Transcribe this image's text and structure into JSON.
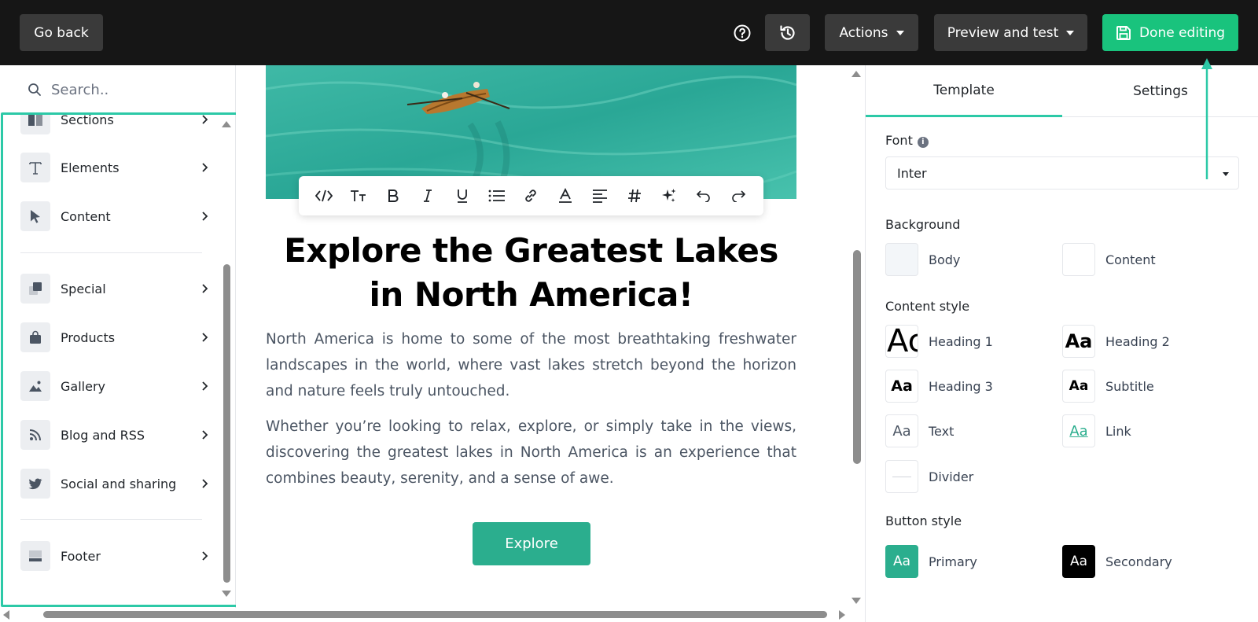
{
  "topbar": {
    "go_back": "Go back",
    "actions": "Actions",
    "preview": "Preview and test",
    "done": "Done editing"
  },
  "sidebar": {
    "search_placeholder": "Search..",
    "items": [
      {
        "label": "Sections",
        "icon": "sections-icon"
      },
      {
        "label": "Elements",
        "icon": "text-icon"
      },
      {
        "label": "Content",
        "icon": "cursor-icon"
      },
      {
        "label": "Special",
        "icon": "layers-icon"
      },
      {
        "label": "Products",
        "icon": "shopping-bag-icon"
      },
      {
        "label": "Gallery",
        "icon": "image-icon"
      },
      {
        "label": "Blog and RSS",
        "icon": "rss-icon"
      },
      {
        "label": "Social and sharing",
        "icon": "twitter-icon"
      },
      {
        "label": "Footer",
        "icon": "footer-icon"
      }
    ]
  },
  "canvas": {
    "headline": "Explore the Greatest Lakes in North America!",
    "para1": "North America is home to some of the most breathtaking freshwater landscapes in the world, where vast lakes stretch beyond the horizon and nature feels truly untouched.",
    "para2": "Whether you’re looking to relax, explore, or simply take in the views, discovering the greatest lakes in North America is an experience that combines beauty, serenity, and a sense of awe.",
    "button": "Explore"
  },
  "right_panel": {
    "tabs": [
      "Template",
      "Settings"
    ],
    "font_title": "Font",
    "font_value": "Inter",
    "background_title": "Background",
    "background": [
      "Body",
      "Content"
    ],
    "content_style_title": "Content style",
    "content_styles": [
      "Heading 1",
      "Heading 2",
      "Heading 3",
      "Subtitle",
      "Text",
      "Link",
      "Divider"
    ],
    "swatch_text": {
      "h1": "Ac",
      "aa": "Aa"
    },
    "button_style_title": "Button style",
    "button_styles": [
      "Primary",
      "Secondary"
    ]
  },
  "colors": {
    "accent": "#2cc9a7",
    "done_button": "#19c37d",
    "explore_button": "#2bae8e",
    "topbar": "#161616",
    "body_swatch": "#f3f6f9"
  }
}
